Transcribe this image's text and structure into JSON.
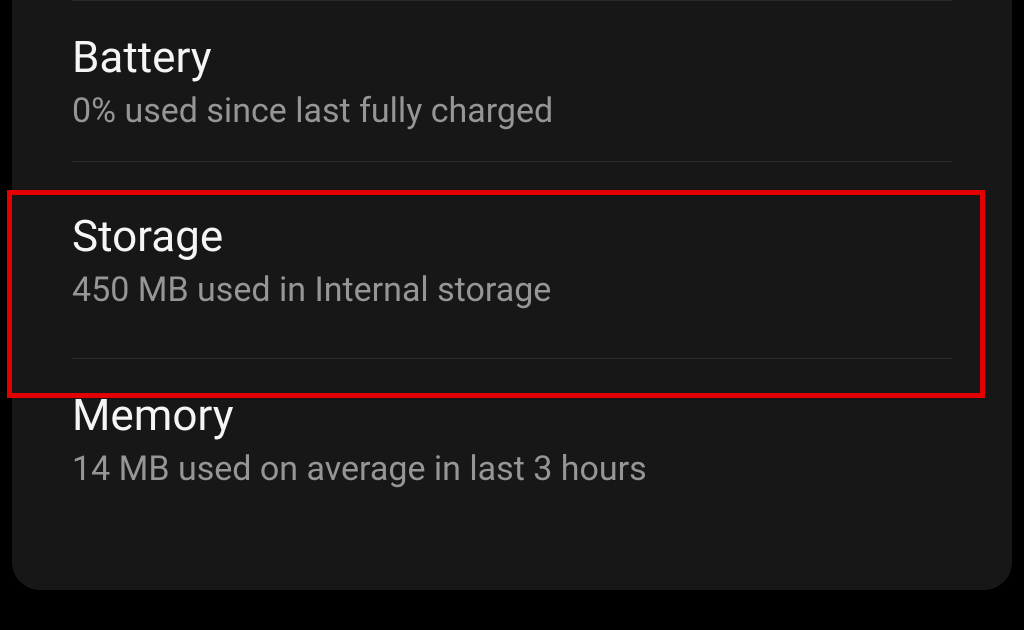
{
  "settings": {
    "battery": {
      "title": "Battery",
      "subtitle": "0% used since last fully charged"
    },
    "storage": {
      "title": "Storage",
      "subtitle": "450 MB used in Internal storage"
    },
    "memory": {
      "title": "Memory",
      "subtitle": "14 MB used on average in last 3 hours"
    }
  }
}
